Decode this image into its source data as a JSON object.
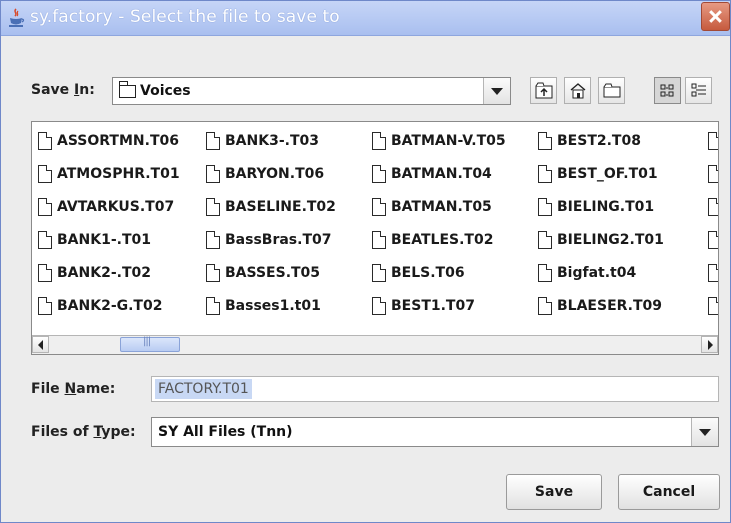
{
  "window": {
    "title": "sy.factory - Select the file to save to"
  },
  "save_in": {
    "label_pre": "Save ",
    "label_mnemonic": "I",
    "label_post": "n:",
    "value": "Voices"
  },
  "toolbar": {
    "buttons": [
      "up-one-level-icon",
      "home-icon",
      "new-folder-icon",
      "list-view-icon",
      "details-view-icon"
    ]
  },
  "files": [
    [
      "ASSORTMN.T06",
      "ATMOSPHR.T01",
      "AVTARKUS.T07",
      "BANK1-.T01",
      "BANK2-.T02",
      "BANK2-G.T02"
    ],
    [
      "BANK3-.T03",
      "BARYON.T06",
      "BASELINE.T02",
      "BassBras.T07",
      "BASSES.T05",
      "Basses1.t01"
    ],
    [
      "BATMAN-V.T05",
      "BATMAN.T04",
      "BATMAN.T05",
      "BEATLES.T02",
      "BELS.T06",
      "BEST1.T07"
    ],
    [
      "BEST2.T08",
      "BEST_OF.T01",
      "BIELING.T01",
      "BIELING2.T01",
      "Bigfat.t04",
      "BLAESER.T09"
    ]
  ],
  "file_name": {
    "label_pre": "File ",
    "label_mnemonic": "N",
    "label_post": "ame:",
    "value": "FACTORY.T01"
  },
  "file_type": {
    "label_pre": "Files of ",
    "label_mnemonic": "T",
    "label_post": "ype:",
    "value": "SY All Files (Tnn)"
  },
  "buttons": {
    "save": "Save",
    "cancel": "Cancel"
  },
  "colors": {
    "titlebar": "#a9bfef",
    "selection": "#c8d8f4"
  }
}
